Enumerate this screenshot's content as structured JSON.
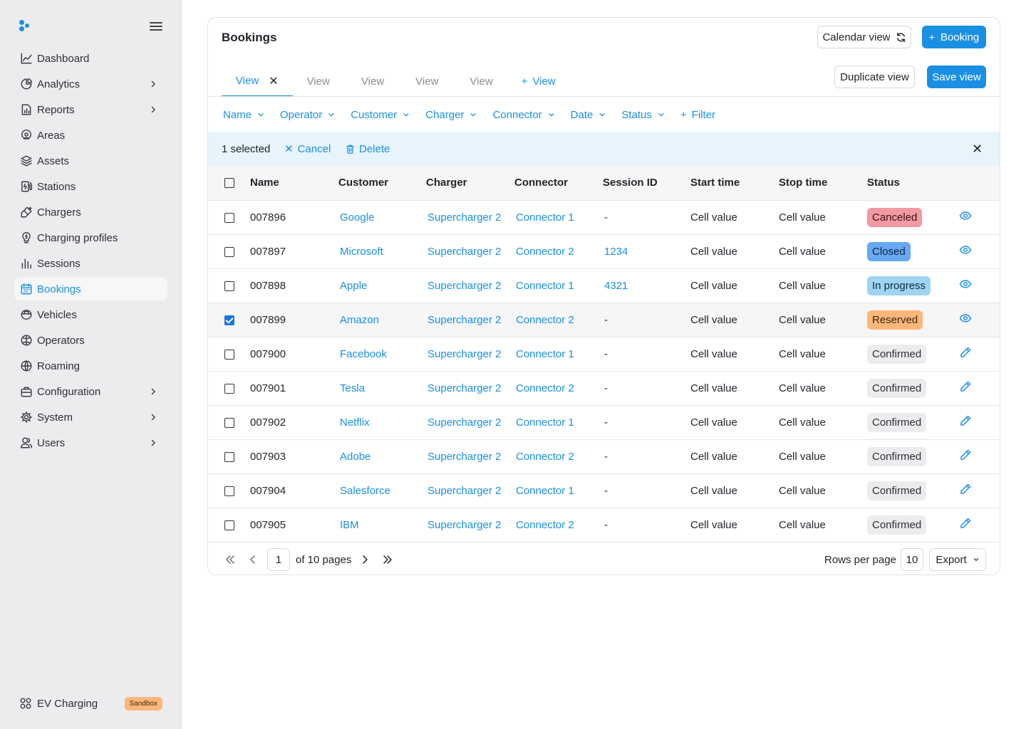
{
  "sidebar": {
    "items": [
      {
        "label": "Dashboard",
        "icon": "dashboard-icon",
        "chevron": false,
        "active": false
      },
      {
        "label": "Analytics",
        "icon": "analytics-icon",
        "chevron": true,
        "active": false
      },
      {
        "label": "Reports",
        "icon": "reports-icon",
        "chevron": true,
        "active": false
      },
      {
        "label": "Areas",
        "icon": "areas-icon",
        "chevron": false,
        "active": false
      },
      {
        "label": "Assets",
        "icon": "assets-icon",
        "chevron": false,
        "active": false
      },
      {
        "label": "Stations",
        "icon": "stations-icon",
        "chevron": false,
        "active": false
      },
      {
        "label": "Chargers",
        "icon": "chargers-icon",
        "chevron": false,
        "active": false
      },
      {
        "label": "Charging profiles",
        "icon": "charging-profiles-icon",
        "chevron": false,
        "active": false
      },
      {
        "label": "Sessions",
        "icon": "sessions-icon",
        "chevron": false,
        "active": false
      },
      {
        "label": "Bookings",
        "icon": "calendar-icon",
        "chevron": false,
        "active": true
      },
      {
        "label": "Vehicles",
        "icon": "vehicle-icon",
        "chevron": false,
        "active": false
      },
      {
        "label": "Operators",
        "icon": "operators-icon",
        "chevron": false,
        "active": false
      },
      {
        "label": "Roaming",
        "icon": "globe-icon",
        "chevron": false,
        "active": false
      },
      {
        "label": "Configuration",
        "icon": "briefcase-icon",
        "chevron": true,
        "active": false
      },
      {
        "label": "System",
        "icon": "gear-icon",
        "chevron": true,
        "active": false
      },
      {
        "label": "Users",
        "icon": "users-icon",
        "chevron": true,
        "active": false
      }
    ],
    "footer": {
      "label": "EV Charging",
      "badge": "Sandbox"
    }
  },
  "header": {
    "title": "Bookings",
    "calendar_view": "Calendar view",
    "add_booking": "Booking",
    "duplicate_view": "Duplicate view",
    "save_view": "Save view"
  },
  "tabs": {
    "active": "View",
    "others": [
      "View",
      "View",
      "View",
      "View"
    ],
    "add": "View"
  },
  "filters": {
    "items": [
      "Name",
      "Operator",
      "Customer",
      "Charger",
      "Connector",
      "Date",
      "Status"
    ],
    "add": "Filter"
  },
  "selection": {
    "count": "1 selected",
    "cancel": "Cancel",
    "delete": "Delete"
  },
  "table": {
    "headers": [
      "Name",
      "Customer",
      "Charger",
      "Connector",
      "Session ID",
      "Start time",
      "Stop time",
      "Status"
    ],
    "rows": [
      {
        "name": "007896",
        "customer": "Google",
        "charger": "Supercharger 2",
        "connector": "Connector 1",
        "session": "-",
        "start": "Cell value",
        "stop": "Cell value",
        "status": "Canceled",
        "status_key": "canceled",
        "action": "eye",
        "checked": false
      },
      {
        "name": "007897",
        "customer": "Microsoft",
        "charger": "Supercharger 2",
        "connector": "Connector 2",
        "session": "1234",
        "start": "Cell value",
        "stop": "Cell value",
        "status": "Closed",
        "status_key": "closed",
        "action": "eye",
        "checked": false
      },
      {
        "name": "007898",
        "customer": "Apple",
        "charger": "Supercharger 2",
        "connector": "Connector 1",
        "session": "4321",
        "start": "Cell value",
        "stop": "Cell value",
        "status": "In progress",
        "status_key": "progress",
        "action": "eye",
        "checked": false
      },
      {
        "name": "007899",
        "customer": "Amazon",
        "charger": "Supercharger 2",
        "connector": "Connector 2",
        "session": "-",
        "start": "Cell value",
        "stop": "Cell value",
        "status": "Reserved",
        "status_key": "reserved",
        "action": "eye",
        "checked": true
      },
      {
        "name": "007900",
        "customer": "Facebook",
        "charger": "Supercharger 2",
        "connector": "Connector 1",
        "session": "-",
        "start": "Cell value",
        "stop": "Cell value",
        "status": "Confirmed",
        "status_key": "confirmed",
        "action": "pencil",
        "checked": false
      },
      {
        "name": "007901",
        "customer": "Tesla",
        "charger": "Supercharger 2",
        "connector": "Connector 2",
        "session": "-",
        "start": "Cell value",
        "stop": "Cell value",
        "status": "Confirmed",
        "status_key": "confirmed",
        "action": "pencil",
        "checked": false
      },
      {
        "name": "007902",
        "customer": "Netflix",
        "charger": "Supercharger 2",
        "connector": "Connector 1",
        "session": "-",
        "start": "Cell value",
        "stop": "Cell value",
        "status": "Confirmed",
        "status_key": "confirmed",
        "action": "pencil",
        "checked": false
      },
      {
        "name": "007903",
        "customer": "Adobe",
        "charger": "Supercharger 2",
        "connector": "Connector 2",
        "session": "-",
        "start": "Cell value",
        "stop": "Cell value",
        "status": "Confirmed",
        "status_key": "confirmed",
        "action": "pencil",
        "checked": false
      },
      {
        "name": "007904",
        "customer": "Salesforce",
        "charger": "Supercharger 2",
        "connector": "Connector 1",
        "session": "-",
        "start": "Cell value",
        "stop": "Cell value",
        "status": "Confirmed",
        "status_key": "confirmed",
        "action": "pencil",
        "checked": false
      },
      {
        "name": "007905",
        "customer": "IBM",
        "charger": "Supercharger 2",
        "connector": "Connector 2",
        "session": "-",
        "start": "Cell value",
        "stop": "Cell value",
        "status": "Confirmed",
        "status_key": "confirmed",
        "action": "pencil",
        "checked": false
      }
    ]
  },
  "status_colors": {
    "canceled": {
      "bg": "#f29aa3",
      "fg": "#3a1014"
    },
    "closed": {
      "bg": "#66a9f2",
      "fg": "#0c2440"
    },
    "progress": {
      "bg": "#9fd4f2",
      "fg": "#0d2c3e"
    },
    "reserved": {
      "bg": "#fbb77a",
      "fg": "#3e2410"
    },
    "confirmed": {
      "bg": "#ececee",
      "fg": "#2c2f33"
    }
  },
  "pagination": {
    "current_page": "1",
    "of_pages": "of 10 pages",
    "rows_per_page_label": "Rows per page",
    "rows_per_page": "10",
    "export": "Export"
  },
  "colors": {
    "accent": "#1a8fe3"
  }
}
